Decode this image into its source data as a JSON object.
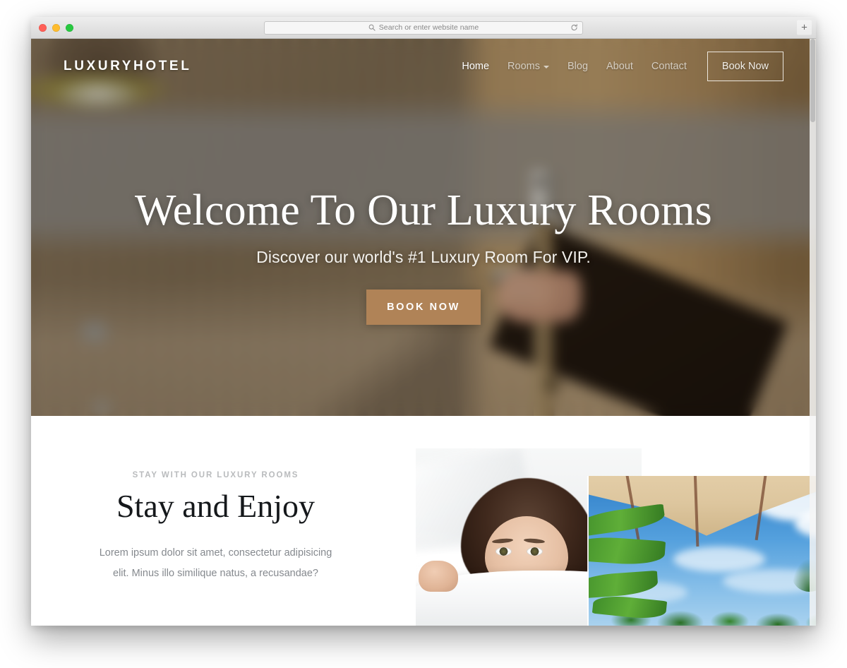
{
  "browser": {
    "traffic_lights": {
      "close_color": "#ff5f57",
      "minimize_color": "#febc2e",
      "zoom_color": "#28c840"
    },
    "address_bar": {
      "value": "",
      "placeholder": "Search or enter website name"
    },
    "reload_label": "",
    "new_tab_label": "+"
  },
  "site": {
    "brand": "LUXURYHOTEL",
    "nav": [
      {
        "label": "Home",
        "active": true,
        "has_caret": false
      },
      {
        "label": "Rooms",
        "active": false,
        "has_caret": true
      },
      {
        "label": "Blog",
        "active": false,
        "has_caret": false
      },
      {
        "label": "About",
        "active": false,
        "has_caret": false
      },
      {
        "label": "Contact",
        "active": false,
        "has_caret": false
      }
    ],
    "nav_cta": "Book Now",
    "hero": {
      "title": "Welcome To Our Luxury Rooms",
      "subtitle": "Discover our world's #1 Luxury Room For VIP.",
      "cta": "BOOK NOW",
      "cta_color": "#b08357",
      "background": "blurred photo of a hand opening a hotel room door"
    },
    "about": {
      "eyebrow": "STAY WITH OUR LUXURY ROOMS",
      "title": "Stay and Enjoy",
      "body": "Lorem ipsum dolor sit amet, consectetur adipisicing elit. Minus illo similique natus, a recusandae?",
      "image_1_alt": "woman in white bed peeking over the duvet",
      "image_2_alt": "beige beach parasol with blue sky and palm trees"
    }
  },
  "colors": {
    "accent": "#b08357",
    "heading": "#15181b",
    "body_text": "#85898e",
    "eyebrow": "#b9bbbd"
  }
}
